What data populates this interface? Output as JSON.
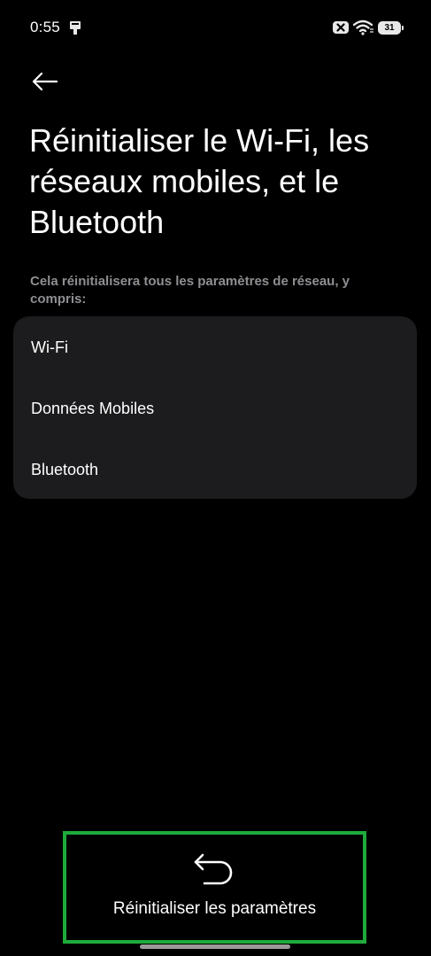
{
  "status_bar": {
    "time": "0:55",
    "battery_level": "31",
    "icons": [
      "notification-app-icon",
      "sim-no-signal-icon",
      "wifi-icon",
      "battery-icon"
    ]
  },
  "header": {
    "back_icon": "arrow-left-icon",
    "title": "Réinitialiser le Wi-Fi, les réseaux mobiles, et le Bluetooth"
  },
  "description": "Cela réinitialisera tous les paramètres de réseau, y compris:",
  "reset_items": [
    {
      "label": "Wi-Fi"
    },
    {
      "label": "Données Mobiles"
    },
    {
      "label": "Bluetooth"
    }
  ],
  "action": {
    "icon": "undo-arrow-icon",
    "label": "Réinitialiser les paramètres"
  },
  "colors": {
    "background": "#000000",
    "card": "#1c1c1e",
    "secondary_text": "#8e8e93",
    "highlight": "#1fab3b"
  }
}
